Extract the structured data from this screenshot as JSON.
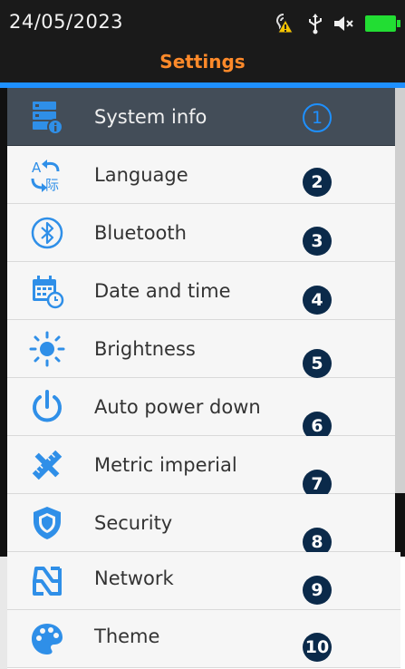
{
  "status": {
    "date": "24/05/2023",
    "icons": [
      "hearing-warning-icon",
      "usb-icon",
      "mute-icon",
      "battery-icon"
    ],
    "battery_color": "#22dd33"
  },
  "header": {
    "title": "Settings",
    "title_color": "#ff8a2a"
  },
  "accent_color": "#1e90ff",
  "menu": {
    "items": [
      {
        "label": "System info",
        "badge": "1",
        "icon": "system-info-icon",
        "selected": true
      },
      {
        "label": "Language",
        "badge": "2",
        "icon": "language-icon"
      },
      {
        "label": "Bluetooth",
        "badge": "3",
        "icon": "bluetooth-icon"
      },
      {
        "label": "Date and time",
        "badge": "4",
        "icon": "calendar-clock-icon"
      },
      {
        "label": "Brightness",
        "badge": "5",
        "icon": "brightness-icon"
      },
      {
        "label": "Auto power down",
        "badge": "6",
        "icon": "power-icon"
      },
      {
        "label": "Metric imperial",
        "badge": "7",
        "icon": "ruler-icon"
      },
      {
        "label": "Security",
        "badge": "8",
        "icon": "shield-icon"
      },
      {
        "label": "Network",
        "badge": "9",
        "icon": "network-icon"
      },
      {
        "label": "Theme",
        "badge": "10",
        "icon": "palette-icon"
      }
    ]
  }
}
